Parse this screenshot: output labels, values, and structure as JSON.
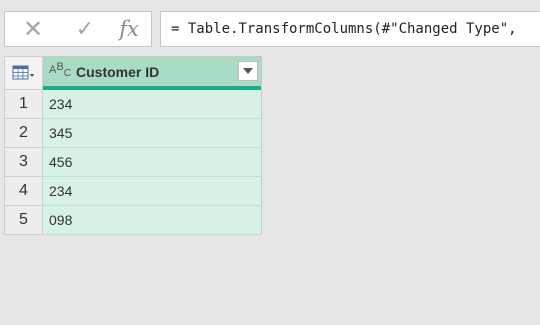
{
  "formula_bar": {
    "cancel_icon": "✕",
    "commit_icon": "✓",
    "fx_label": "fx",
    "formula": "= Table.TransformColumns(#\"Changed Type\","
  },
  "table": {
    "column": {
      "type_icon": {
        "main": "A",
        "sup": "B",
        "sub": "C"
      },
      "title": "Customer ID"
    },
    "rows": [
      {
        "num": "1",
        "value": "234"
      },
      {
        "num": "2",
        "value": "345"
      },
      {
        "num": "3",
        "value": "456"
      },
      {
        "num": "4",
        "value": "234"
      },
      {
        "num": "5",
        "value": "098"
      }
    ]
  },
  "colors": {
    "header": "#a9dcc4",
    "header_accent": "#1faa8b",
    "cell": "#d7f1e5"
  }
}
